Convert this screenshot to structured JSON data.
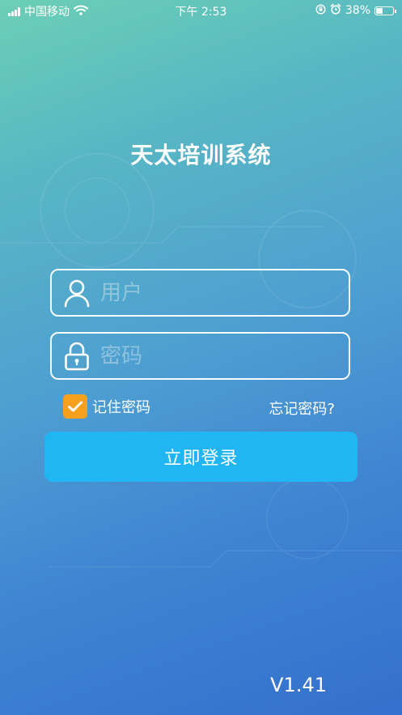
{
  "status_bar": {
    "carrier": "中国移动",
    "time": "下午 2:53",
    "battery": "38%",
    "battery_level": 0.38,
    "icons": [
      "signal-icon",
      "wifi-icon",
      "orientation-lock-icon",
      "alarm-icon",
      "battery-icon"
    ]
  },
  "app": {
    "title": "天太培训系统"
  },
  "login_form": {
    "username_placeholder": "用户",
    "password_placeholder": "密码",
    "remember_label": "记住密码",
    "remember_checked": true,
    "forgot_label": "忘记密码?",
    "submit_label": "立即登录"
  },
  "footer": {
    "version": "V1.41"
  },
  "colors": {
    "checkbox": "#f5a01e",
    "button": "#21b5f4",
    "gradient_top": "#6ccfb5",
    "gradient_bottom": "#3470cd"
  }
}
